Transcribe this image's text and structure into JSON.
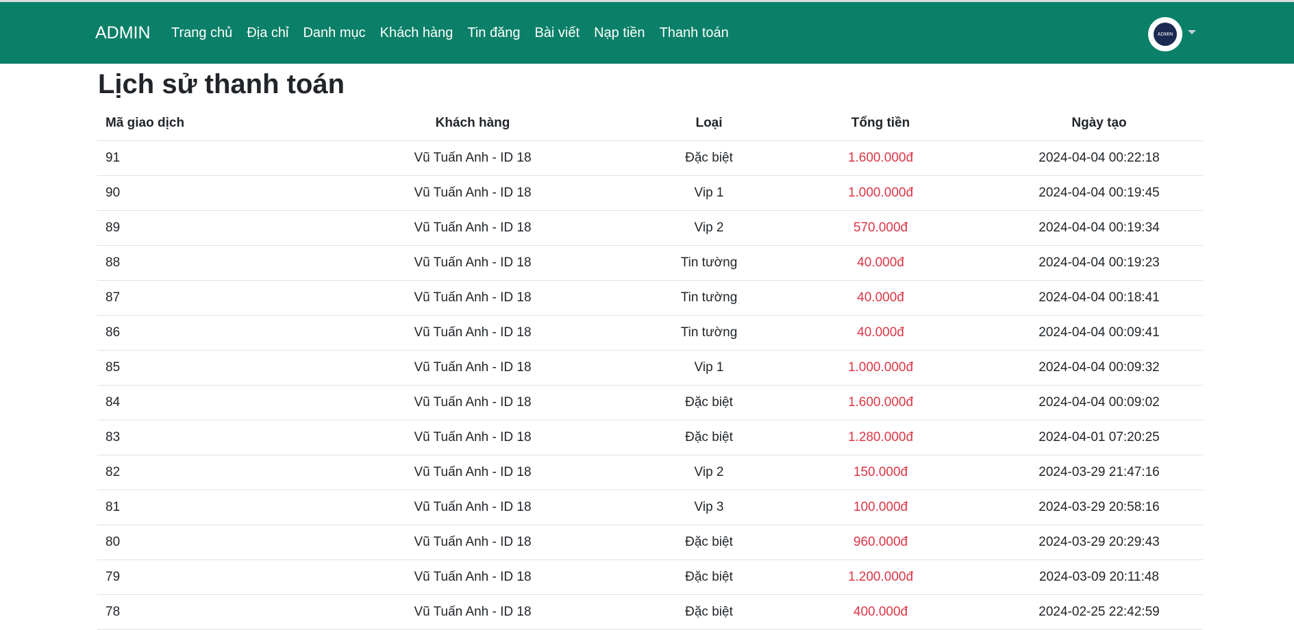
{
  "nav": {
    "brand": "ADMIN",
    "items": [
      "Trang chủ",
      "Địa chỉ",
      "Danh mục",
      "Khách hàng",
      "Tin đăng",
      "Bài viết",
      "Nạp tiền",
      "Thanh toán"
    ],
    "avatar_text": "ADMIN"
  },
  "page": {
    "title": "Lịch sử thanh toán"
  },
  "table": {
    "headers": [
      "Mã giao dịch",
      "Khách hàng",
      "Loại",
      "Tổng tiền",
      "Ngày tạo"
    ],
    "rows": [
      [
        "91",
        "Vũ Tuấn Anh - ID 18",
        "Đặc biệt",
        "1.600.000đ",
        "2024-04-04 00:22:18"
      ],
      [
        "90",
        "Vũ Tuấn Anh - ID 18",
        "Vip 1",
        "1.000.000đ",
        "2024-04-04 00:19:45"
      ],
      [
        "89",
        "Vũ Tuấn Anh - ID 18",
        "Vip 2",
        "570.000đ",
        "2024-04-04 00:19:34"
      ],
      [
        "88",
        "Vũ Tuấn Anh - ID 18",
        "Tin tường",
        "40.000đ",
        "2024-04-04 00:19:23"
      ],
      [
        "87",
        "Vũ Tuấn Anh - ID 18",
        "Tin tường",
        "40.000đ",
        "2024-04-04 00:18:41"
      ],
      [
        "86",
        "Vũ Tuấn Anh - ID 18",
        "Tin tường",
        "40.000đ",
        "2024-04-04 00:09:41"
      ],
      [
        "85",
        "Vũ Tuấn Anh - ID 18",
        "Vip 1",
        "1.000.000đ",
        "2024-04-04 00:09:32"
      ],
      [
        "84",
        "Vũ Tuấn Anh - ID 18",
        "Đặc biệt",
        "1.600.000đ",
        "2024-04-04 00:09:02"
      ],
      [
        "83",
        "Vũ Tuấn Anh - ID 18",
        "Đặc biệt",
        "1.280.000đ",
        "2024-04-01 07:20:25"
      ],
      [
        "82",
        "Vũ Tuấn Anh - ID 18",
        "Vip 2",
        "150.000đ",
        "2024-03-29 21:47:16"
      ],
      [
        "81",
        "Vũ Tuấn Anh - ID 18",
        "Vip 3",
        "100.000đ",
        "2024-03-29 20:58:16"
      ],
      [
        "80",
        "Vũ Tuấn Anh - ID 18",
        "Đặc biệt",
        "960.000đ",
        "2024-03-29 20:29:43"
      ],
      [
        "79",
        "Vũ Tuấn Anh - ID 18",
        "Đặc biệt",
        "1.200.000đ",
        "2024-03-09 20:11:48"
      ],
      [
        "78",
        "Vũ Tuấn Anh - ID 18",
        "Đặc biệt",
        "400.000đ",
        "2024-02-25 22:42:59"
      ]
    ]
  },
  "colors": {
    "navbar": "#0b8068",
    "money": "#dc3545",
    "avatar_inner": "#1b2a52"
  }
}
